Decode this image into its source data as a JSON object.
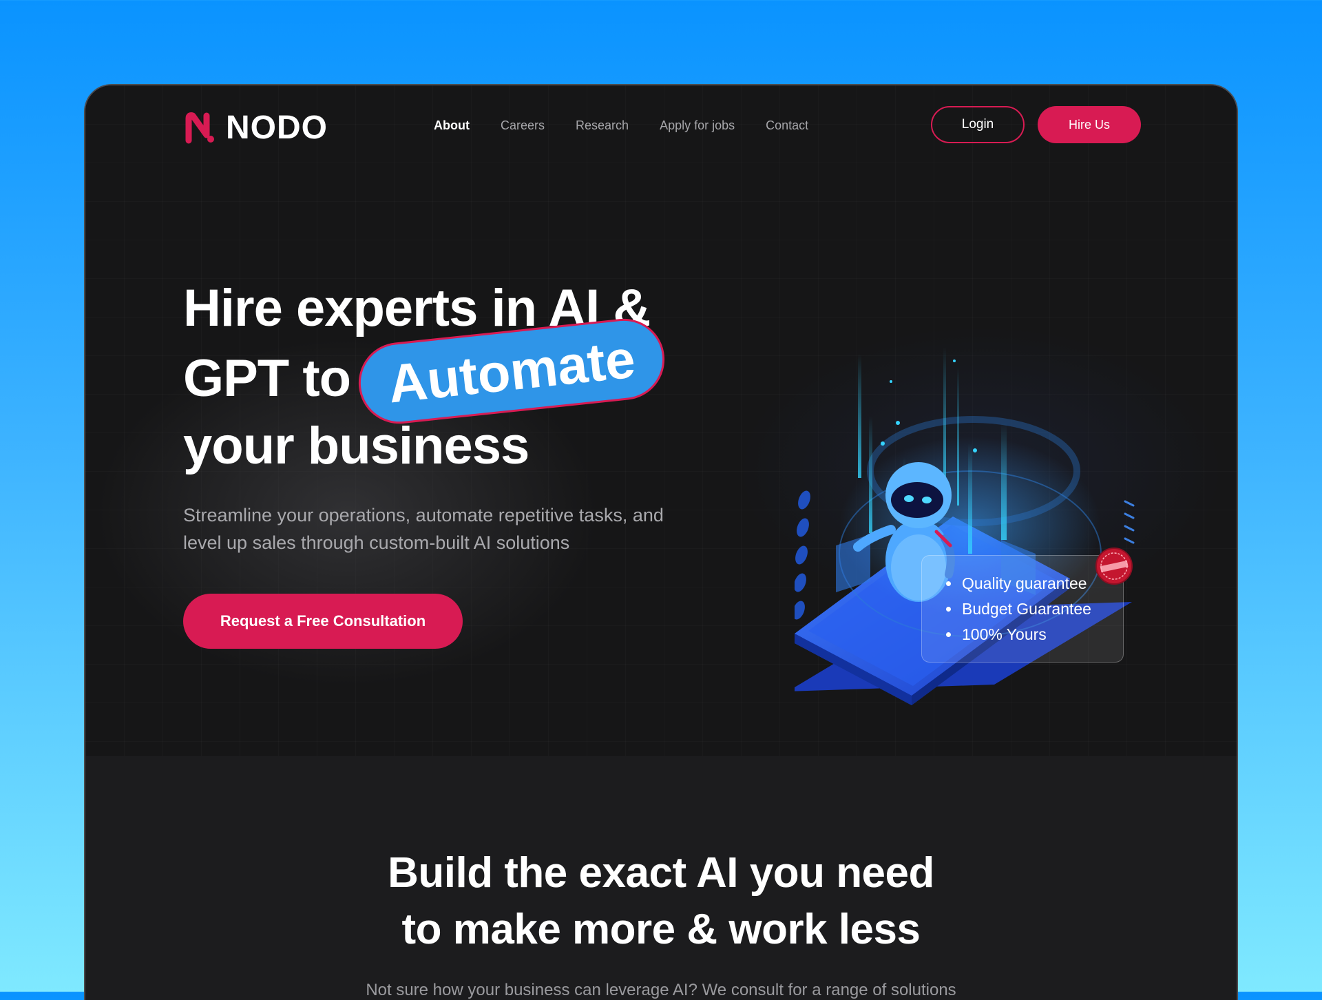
{
  "brand": {
    "name": "NODO",
    "accent": "#d81b53",
    "highlight": "#2f95e8"
  },
  "nav": {
    "items": [
      {
        "label": "About",
        "active": true
      },
      {
        "label": "Careers",
        "active": false
      },
      {
        "label": "Research",
        "active": false
      },
      {
        "label": "Apply for jobs",
        "active": false
      },
      {
        "label": "Contact",
        "active": false
      }
    ],
    "login_label": "Login",
    "hire_label": "Hire Us"
  },
  "hero": {
    "headline_line1": "Hire experts in AI &",
    "headline_line2_prefix": "GPT to",
    "headline_highlight": "Automate",
    "headline_line3": "your business",
    "subtitle": "Streamline your operations, automate repetitive tasks, and level up sales through custom-built AI solutions",
    "cta_label": "Request a Free Consultation",
    "guarantees": [
      "Quality guarantee",
      "Budget Guarantee",
      "100% Yours"
    ],
    "stamp_text": "GUARANTEED"
  },
  "section2": {
    "heading_line1": "Build the exact AI you need",
    "heading_line2": "to make more & work less",
    "paragraph": "Not sure how your business can leverage AI? We consult for a range of solutions"
  }
}
